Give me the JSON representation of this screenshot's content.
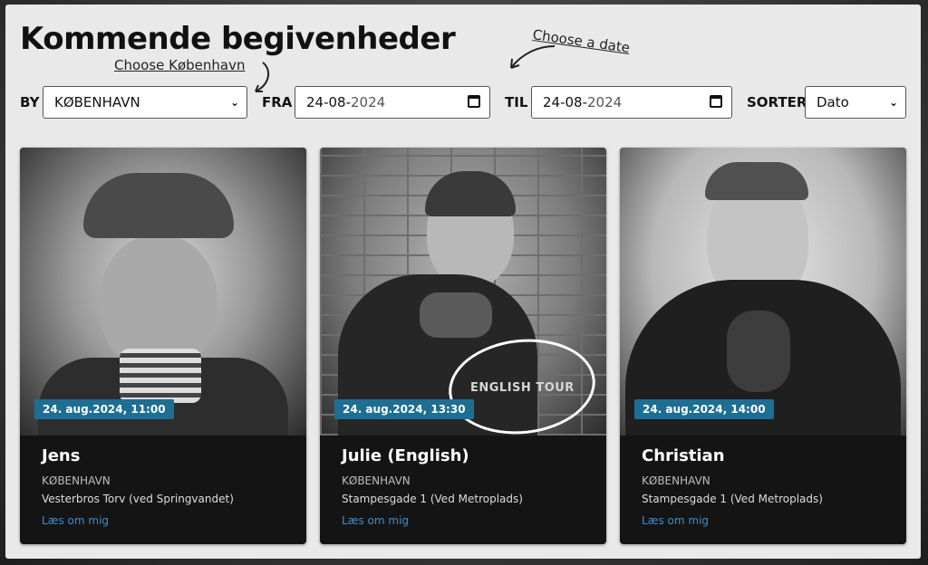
{
  "page": {
    "title": "Kommende begivenheder",
    "hint_city": "Choose København",
    "hint_date": "Choose a date"
  },
  "filters": {
    "city_label": "BY",
    "city_value": "KØBENHAVN",
    "from_label": "FRA",
    "from_value_day": "24-08-",
    "from_value_year": "2024",
    "to_label": "TIL",
    "to_value_day": "24-08-",
    "to_value_year": "2024",
    "sort_label": "SORTER",
    "sort_value": "Dato"
  },
  "events": [
    {
      "badge": "24. aug.2024, 11:00",
      "name": "Jens",
      "city": "KØBENHAVN",
      "address": "Vesterbros Torv (ved Springvandet)",
      "link": "Læs om mig"
    },
    {
      "badge": "24. aug.2024, 13:30",
      "name": "Julie (English)",
      "city": "KØBENHAVN",
      "address": "Stampesgade 1 (Ved Metroplads)",
      "link": "Læs om mig",
      "overlay": "ENGLISH TOUR"
    },
    {
      "badge": "24. aug.2024, 14:00",
      "name": "Christian",
      "city": "KØBENHAVN",
      "address": "Stampesgade 1 (Ved Metroplads)",
      "link": "Læs om mig"
    }
  ],
  "colors": {
    "badge_bg": "#1d6e93",
    "link": "#3b8fd0",
    "panel_bg": "#e9e9e9",
    "card_bg": "#141414"
  },
  "icons": [
    "arrow-curved-icon",
    "calendar-icon",
    "chevron-down-icon"
  ]
}
